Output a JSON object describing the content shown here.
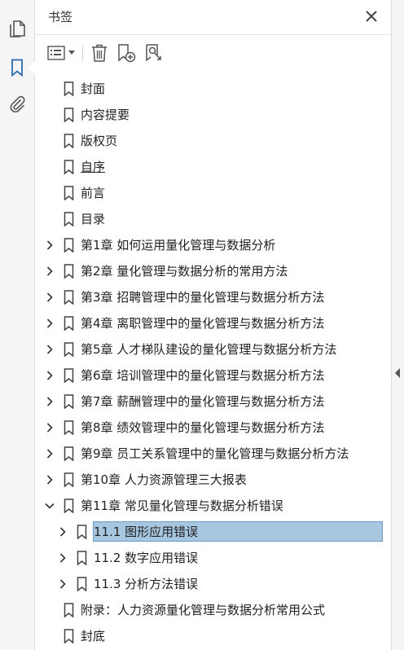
{
  "panel": {
    "title": "书签"
  },
  "rail": {
    "items": [
      {
        "icon": "pages-icon"
      },
      {
        "icon": "bookmark-icon",
        "active": true
      },
      {
        "icon": "attachment-icon"
      }
    ]
  },
  "toolbar": {
    "tools": [
      "options-menu",
      "delete",
      "new-bookmark",
      "bookmark-search"
    ]
  },
  "bookmarks": [
    {
      "label": "封面",
      "level": 0,
      "expand": "none"
    },
    {
      "label": "内容提要",
      "level": 0,
      "expand": "none"
    },
    {
      "label": "版权页",
      "level": 0,
      "expand": "none"
    },
    {
      "label": "自序",
      "level": 0,
      "expand": "none",
      "underline": true
    },
    {
      "label": "前言",
      "level": 0,
      "expand": "none"
    },
    {
      "label": "目录",
      "level": 0,
      "expand": "none"
    },
    {
      "label": "第1章 如何运用量化管理与数据分析",
      "level": 0,
      "expand": "collapsed"
    },
    {
      "label": "第2章 量化管理与数据分析的常用方法",
      "level": 0,
      "expand": "collapsed"
    },
    {
      "label": "第3章 招聘管理中的量化管理与数据分析方法",
      "level": 0,
      "expand": "collapsed"
    },
    {
      "label": "第4章 离职管理中的量化管理与数据分析方法",
      "level": 0,
      "expand": "collapsed"
    },
    {
      "label": "第5章 人才梯队建设的量化管理与数据分析方法",
      "level": 0,
      "expand": "collapsed"
    },
    {
      "label": "第6章 培训管理中的量化管理与数据分析方法",
      "level": 0,
      "expand": "collapsed"
    },
    {
      "label": "第7章 薪酬管理中的量化管理与数据分析方法",
      "level": 0,
      "expand": "collapsed"
    },
    {
      "label": "第8章 绩效管理中的量化管理与数据分析方法",
      "level": 0,
      "expand": "collapsed"
    },
    {
      "label": "第9章 员工关系管理中的量化管理与数据分析方法",
      "level": 0,
      "expand": "collapsed"
    },
    {
      "label": "第10章 人力资源管理三大报表",
      "level": 0,
      "expand": "collapsed"
    },
    {
      "label": "第11章 常见量化管理与数据分析错误",
      "level": 0,
      "expand": "expanded"
    },
    {
      "label": "11.1 图形应用错误",
      "level": 1,
      "expand": "collapsed",
      "selected": true
    },
    {
      "label": "11.2 数字应用错误",
      "level": 1,
      "expand": "collapsed"
    },
    {
      "label": "11.3 分析方法错误",
      "level": 1,
      "expand": "collapsed"
    },
    {
      "label": "附录：人力资源量化管理与数据分析常用公式",
      "level": 0,
      "expand": "none"
    },
    {
      "label": "封底",
      "level": 0,
      "expand": "none"
    }
  ]
}
